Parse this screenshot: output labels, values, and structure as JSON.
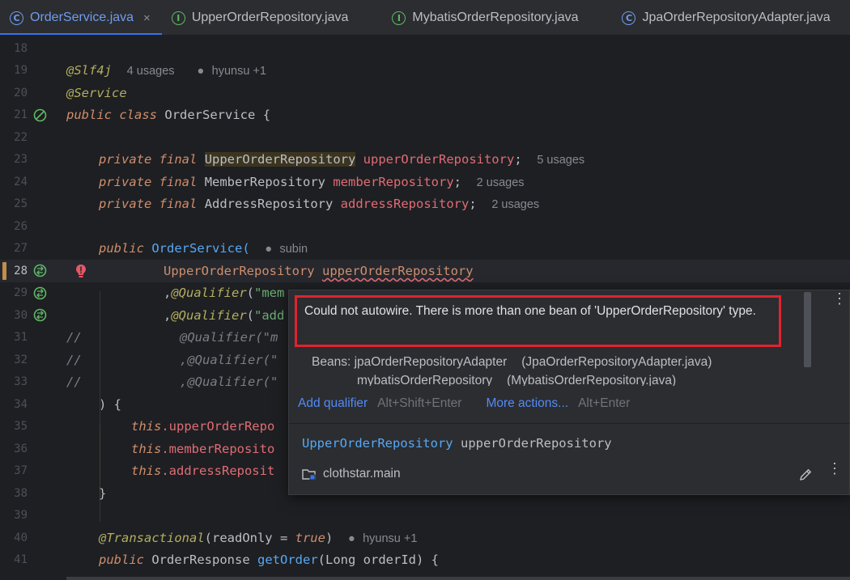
{
  "tabs": [
    {
      "label": "OrderService.java",
      "icon": "class",
      "icon_glyph": "C",
      "active": true,
      "closable": true
    },
    {
      "label": "UpperOrderRepository.java",
      "icon": "interface",
      "icon_glyph": "I"
    },
    {
      "label": "MybatisOrderRepository.java",
      "icon": "interface",
      "icon_glyph": "I"
    },
    {
      "label": "JpaOrderRepositoryAdapter.java",
      "icon": "class",
      "icon_glyph": "C"
    }
  ],
  "close_glyph": "×",
  "lines": {
    "l18": "18",
    "l19": "19",
    "l20": "20",
    "l21": "21",
    "l22": "22",
    "l23": "23",
    "l24": "24",
    "l25": "25",
    "l26": "26",
    "l27": "27",
    "l28": "28",
    "l29": "29",
    "l30": "30",
    "l31": "31",
    "l32": "32",
    "l33": "33",
    "l34": "34",
    "l35": "35",
    "l36": "36",
    "l37": "37",
    "l38": "38",
    "l39": "39",
    "l40": "40",
    "l41": "41"
  },
  "code": {
    "slf4j": "@Slf4j",
    "slf4j_usages": "4 usages",
    "slf4j_author": "hyunsu +1",
    "service": "@Service",
    "kw_public": "public",
    "kw_class": "class",
    "kw_private": "private",
    "kw_final": "final",
    "class_name": "OrderService",
    "open_brace": "{",
    "close_brace": "}",
    "type_upper": "UpperOrderRepository",
    "field_upper": "upperOrderRepository",
    "usages_5": "5 usages",
    "type_member": "MemberRepository",
    "field_member": "memberRepository",
    "usages_2a": "2 usages",
    "type_address": "AddressRepository",
    "field_address": "addressRepository",
    "usages_2b": "2 usages",
    "semicolon": ";",
    "ctor_name": "OrderService",
    "ctor_paren": "(",
    "ctor_author": "subin",
    "param_type": "UpperOrderRepository",
    "param_name": "upperOrderRepository",
    "qual_comma": ",",
    "qual_ann": "@Qualifier",
    "qual_open": "(",
    "qual_str29": "\"mem",
    "qual_str30": "\"add",
    "comment_slashes": "//",
    "comment31": "@Qualifier(\"m",
    "comment32": ",@Qualifier(\"",
    "comment33": ",@Qualifier(\"",
    "ctor_close": ") {",
    "this_kw": "this",
    "this35": ".upperOrderRepo",
    "this36": ".memberReposito",
    "this37": ".addressReposit",
    "transactional": "@Transactional",
    "read_only": "(readOnly = ",
    "true_kw": "true",
    "read_only_close": ")",
    "tx_author": "hyunsu +1",
    "get_order_type": "OrderResponse",
    "get_order_name": "getOrder",
    "get_order_params": "(Long orderId) {"
  },
  "popup": {
    "error_message": "Could not autowire. There is more than one bean of 'UpperOrderRepository' type.",
    "beans_label": "Beans:",
    "bean1_name": "jpaOrderRepositoryAdapter",
    "bean1_file": "(JpaOrderRepositoryAdapter.java)",
    "bean2_name": "mybatisOrderRepository",
    "bean2_file": "(MybatisOrderRepository.java)",
    "action1_label": "Add qualifier",
    "action1_shortcut": "Alt+Shift+Enter",
    "action2_label": "More actions...",
    "action2_shortcut": "Alt+Enter",
    "decl_type": "UpperOrderRepository",
    "decl_name": "upperOrderRepository",
    "module": "clothstar.main",
    "menu_glyph": "⋮"
  },
  "colors": {
    "accent": "#3574f0",
    "error_box": "#e0232f",
    "link": "#548af7"
  }
}
